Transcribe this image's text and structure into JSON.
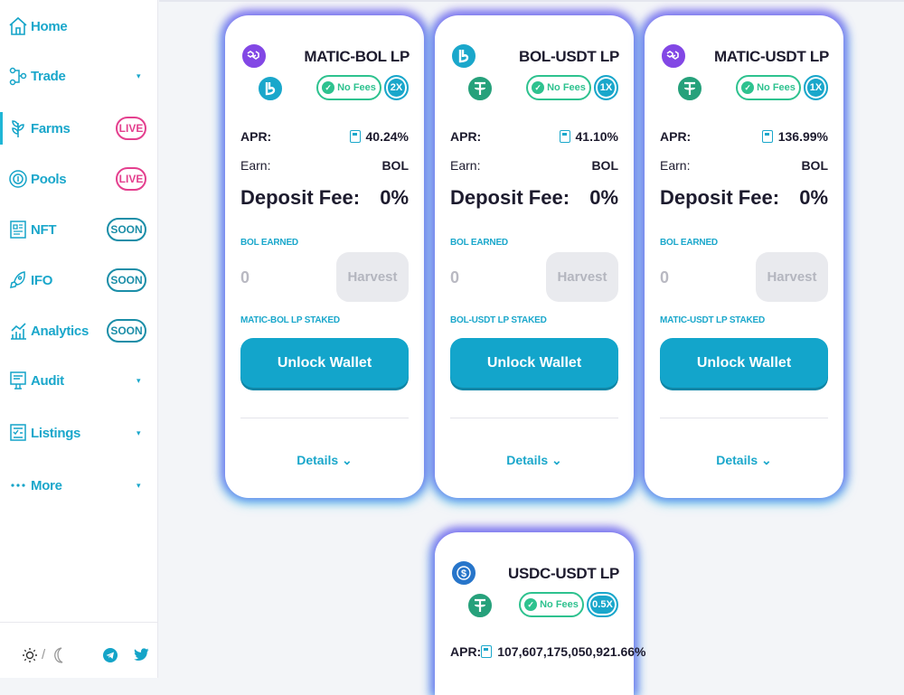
{
  "sidebar": {
    "items": [
      {
        "label": "Home",
        "icon": "home-icon",
        "badge": "",
        "caret": false
      },
      {
        "label": "Trade",
        "icon": "trade-icon",
        "badge": "",
        "caret": true
      },
      {
        "label": "Farms",
        "icon": "farms-icon",
        "badge": "LIVE",
        "caret": false
      },
      {
        "label": "Pools",
        "icon": "pools-icon",
        "badge": "LIVE",
        "caret": false
      },
      {
        "label": "NFT",
        "icon": "nft-icon",
        "badge": "SOON",
        "caret": false
      },
      {
        "label": "IFO",
        "icon": "ifo-icon",
        "badge": "SOON",
        "caret": false
      },
      {
        "label": "Analytics",
        "icon": "analytics-icon",
        "badge": "SOON",
        "caret": false
      },
      {
        "label": "Audit",
        "icon": "audit-icon",
        "badge": "",
        "caret": true
      },
      {
        "label": "Listings",
        "icon": "listings-icon",
        "badge": "",
        "caret": true
      },
      {
        "label": "More",
        "icon": "more-icon",
        "badge": "",
        "caret": true
      }
    ],
    "caret_glyph": "▾",
    "theme_separator": "/"
  },
  "common": {
    "apr_label": "APR:",
    "earn_label": "Earn:",
    "deposit_label": "Deposit Fee:",
    "earned_label": "BOL EARNED",
    "harvest_label": "Harvest",
    "unlock_label": "Unlock Wallet",
    "details_label": "Details",
    "details_caret": "⌄",
    "no_fees_label": "No Fees"
  },
  "farms": [
    {
      "pair": "MATIC-BOL LP",
      "multiplier": "2X",
      "apr": "40.24%",
      "earn": "BOL",
      "deposit_fee": "0%",
      "earned_value": "0",
      "staked_label": "MATIC-BOL LP STAKED",
      "token_a": "matic",
      "token_b": "bol"
    },
    {
      "pair": "BOL-USDT LP",
      "multiplier": "1X",
      "apr": "41.10%",
      "earn": "BOL",
      "deposit_fee": "0%",
      "earned_value": "0",
      "staked_label": "BOL-USDT LP STAKED",
      "token_a": "bol",
      "token_b": "usdt"
    },
    {
      "pair": "MATIC-USDT LP",
      "multiplier": "1X",
      "apr": "136.99%",
      "earn": "BOL",
      "deposit_fee": "0%",
      "earned_value": "0",
      "staked_label": "MATIC-USDT LP STAKED",
      "token_a": "matic",
      "token_b": "usdt"
    },
    {
      "pair": "USDC-USDT LP",
      "multiplier": "0.5X",
      "apr": "107,607,175,050,921.66%",
      "earn": "",
      "deposit_fee": "",
      "earned_value": "",
      "staked_label": "",
      "token_a": "usdc",
      "token_b": "usdt"
    }
  ],
  "colors": {
    "accent": "#1aa7cb",
    "live": "#e43f8e",
    "nofees": "#2ec28f",
    "matic": "#8247e5",
    "bol": "#1aa7cb",
    "usdt": "#26a17b",
    "usdc": "#2775ca"
  }
}
